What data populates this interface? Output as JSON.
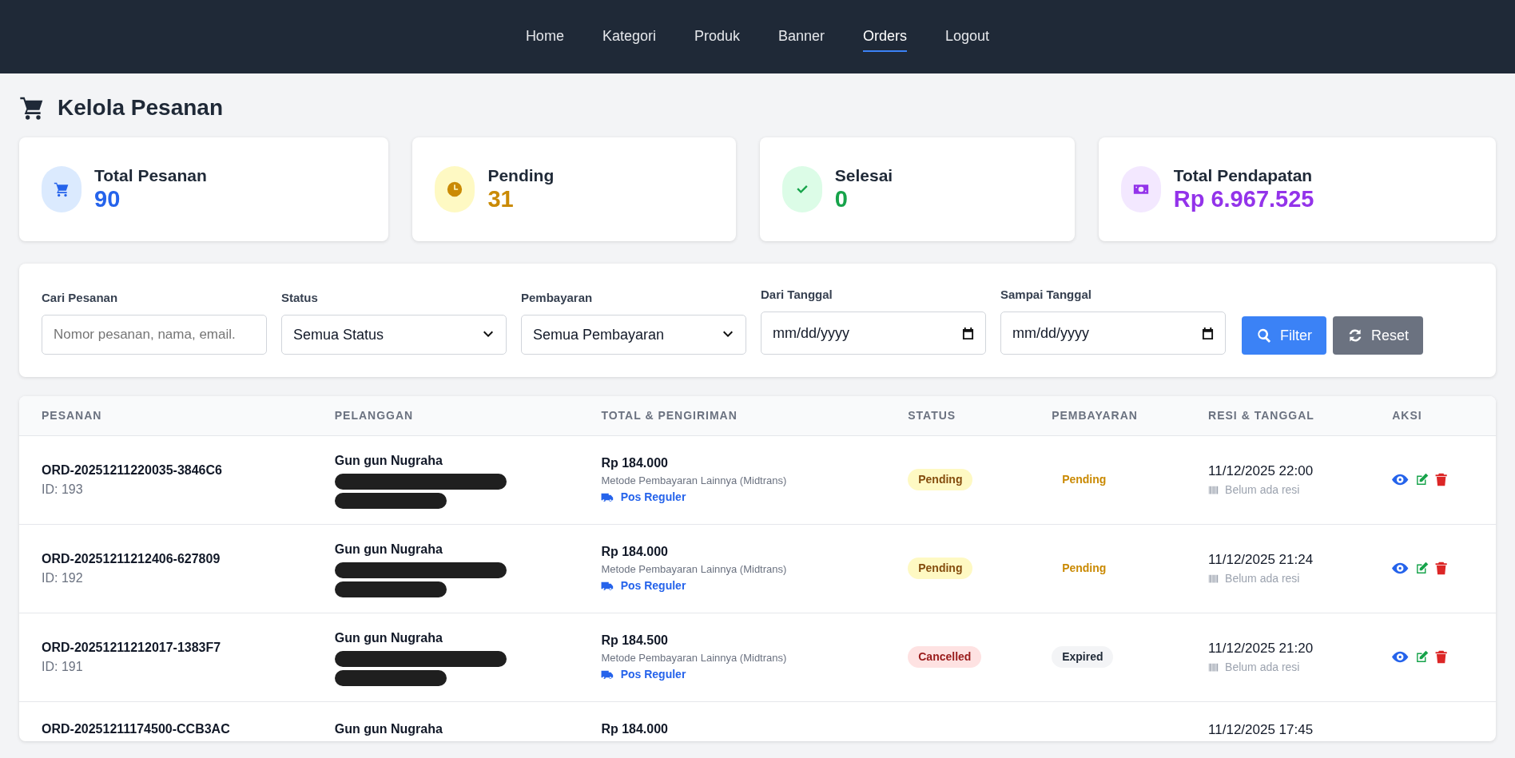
{
  "nav": [
    {
      "label": "Home",
      "selected": false
    },
    {
      "label": "Kategori",
      "selected": false
    },
    {
      "label": "Produk",
      "selected": false
    },
    {
      "label": "Banner",
      "selected": false
    },
    {
      "label": "Orders",
      "selected": true
    },
    {
      "label": "Logout",
      "selected": false
    }
  ],
  "page_title": "Kelola Pesanan",
  "stats": [
    {
      "kind": "orders",
      "label": "Total Pesanan",
      "value": "90"
    },
    {
      "kind": "pending",
      "label": "Pending",
      "value": "31"
    },
    {
      "kind": "done",
      "label": "Selesai",
      "value": "0"
    },
    {
      "kind": "revenue",
      "label": "Total Pendapatan",
      "value": "Rp 6.967.525"
    }
  ],
  "filters": [
    {
      "kind": "text",
      "label": "Cari Pesanan",
      "placeholder": "Nomor pesanan, nama, email."
    },
    {
      "kind": "select",
      "label": "Status",
      "value": "Semua Status"
    },
    {
      "kind": "select",
      "label": "Pembayaran",
      "value": "Semua Pembayaran"
    },
    {
      "kind": "date",
      "label": "Dari Tanggal",
      "value": "mm/dd/yyyy"
    },
    {
      "kind": "date",
      "label": "Sampai Tanggal",
      "value": "mm/dd/yyyy"
    }
  ],
  "buttons": [
    {
      "kind": "filter",
      "label": "Filter"
    },
    {
      "kind": "reset",
      "label": "Reset"
    }
  ],
  "table": {
    "columns": [
      "PESANAN",
      "PELANGGAN",
      "TOTAL & PENGIRIMAN",
      "STATUS",
      "PEMBAYARAN",
      "RESI & TANGGAL",
      "AKSI"
    ],
    "rows": [
      {
        "order_no": "ORD-20251211220035-3846C6",
        "id": "ID: 193",
        "customer": "Gun gun Nugraha",
        "redacted": true,
        "total": "Rp 184.000",
        "payment_method": "Metode Pembayaran Lainnya (Midtrans)",
        "shipping": "Pos Reguler",
        "status": {
          "text": "Pending",
          "kind": "pending"
        },
        "payment": {
          "text": "Pending",
          "kind": "pending"
        },
        "date": "11/12/2025 22:00",
        "receipt": "Belum ada resi",
        "actions": true
      },
      {
        "order_no": "ORD-20251211212406-627809",
        "id": "ID: 192",
        "customer": "Gun gun Nugraha",
        "redacted": true,
        "total": "Rp 184.000",
        "payment_method": "Metode Pembayaran Lainnya (Midtrans)",
        "shipping": "Pos Reguler",
        "status": {
          "text": "Pending",
          "kind": "pending"
        },
        "payment": {
          "text": "Pending",
          "kind": "pending"
        },
        "date": "11/12/2025 21:24",
        "receipt": "Belum ada resi",
        "actions": true
      },
      {
        "order_no": "ORD-20251211212017-1383F7",
        "id": "ID: 191",
        "customer": "Gun gun Nugraha",
        "redacted": true,
        "total": "Rp 184.500",
        "payment_method": "Metode Pembayaran Lainnya (Midtrans)",
        "shipping": "Pos Reguler",
        "status": {
          "text": "Cancelled",
          "kind": "cancelled"
        },
        "payment": {
          "text": "Expired",
          "kind": "expired"
        },
        "date": "11/12/2025 21:20",
        "receipt": "Belum ada resi",
        "actions": true
      },
      {
        "order_no": "ORD-20251211174500-CCB3AC",
        "customer": "Gun gun Nugraha",
        "redacted": false,
        "total": "Rp 184.000",
        "date": "11/12/2025 17:45",
        "actions": false
      }
    ]
  }
}
